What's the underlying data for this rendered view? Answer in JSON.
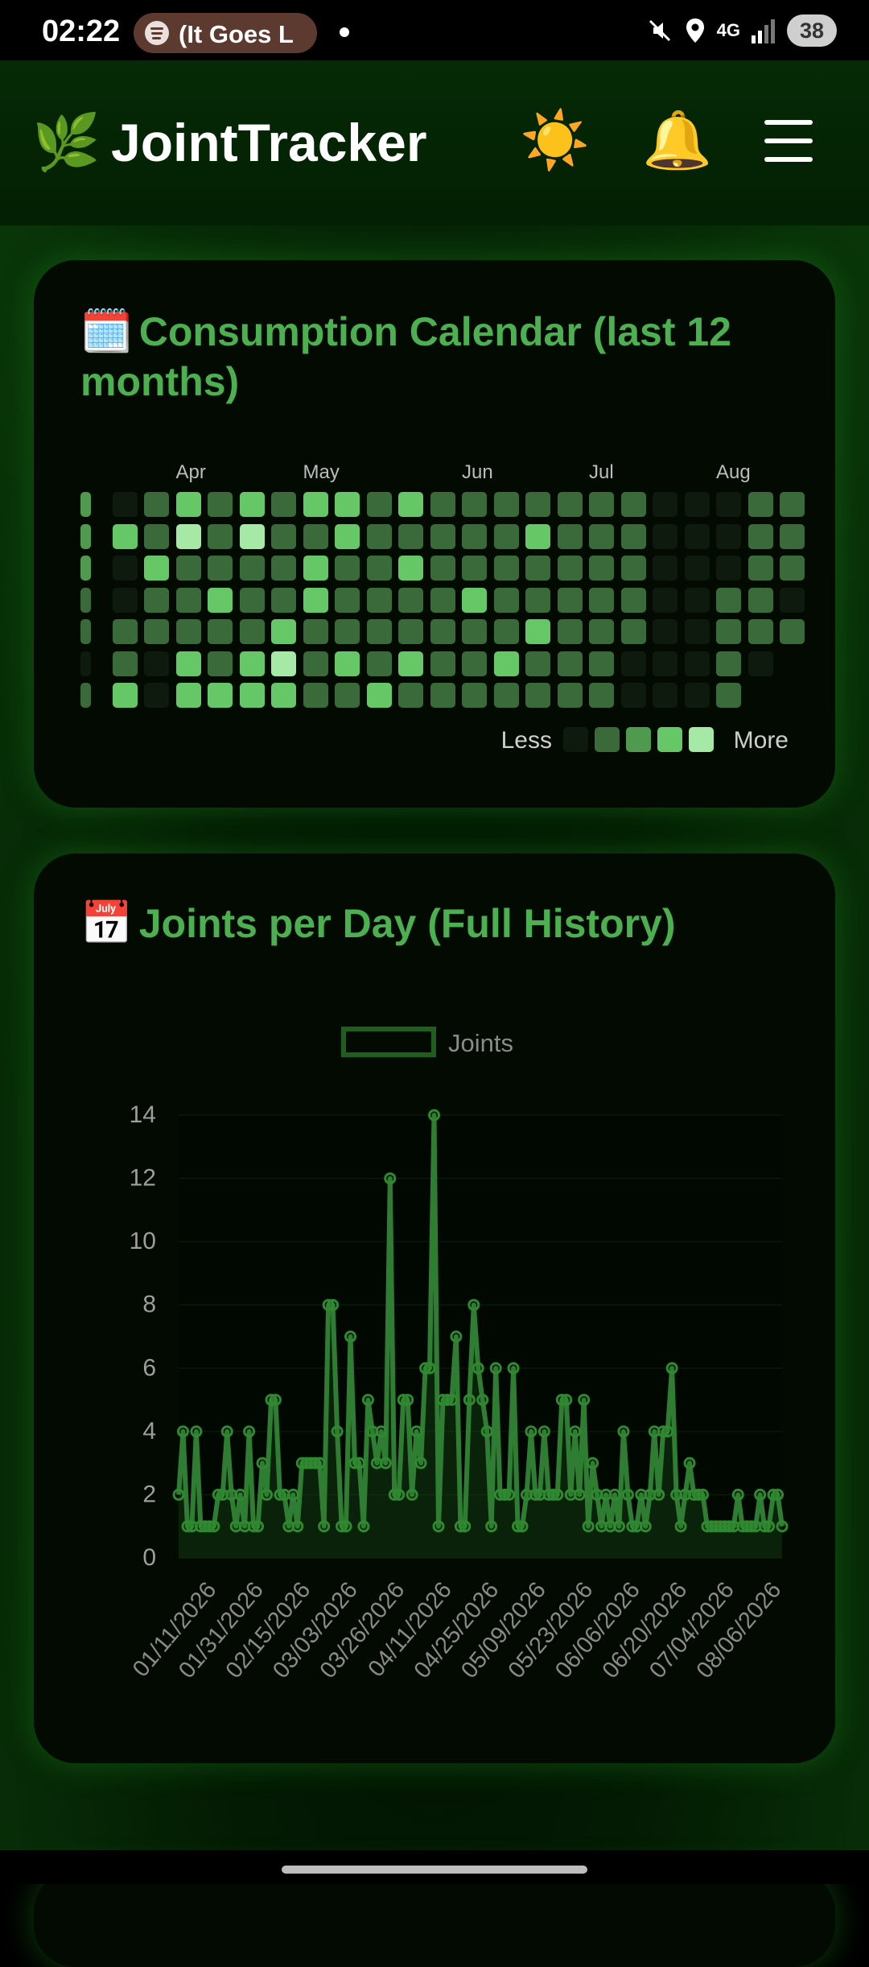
{
  "status_bar": {
    "time": "02:22",
    "now_playing": "(It Goes L",
    "network": "4G",
    "battery": "38"
  },
  "header": {
    "logo_emoji": "🌿",
    "title": "JointTracker",
    "theme_icon": "☀️",
    "bell_icon": "🔔"
  },
  "calendar_card": {
    "emoji": "🗓️",
    "title": "Consumption Calendar (last 12 months)",
    "months": [
      "Apr",
      "May",
      "Jun",
      "Jul",
      "Aug"
    ],
    "month_columns": [
      3,
      7,
      12,
      16,
      20
    ],
    "legend_less": "Less",
    "legend_more": "More",
    "level_colors": [
      "#0f1a0f",
      "#3a6a3a",
      "#4f9a4f",
      "#66c766",
      "#a6e8a6"
    ],
    "first_column_partial": true,
    "weeks": [
      [
        2,
        2,
        2,
        1,
        1,
        0,
        1
      ],
      [
        0,
        3,
        0,
        0,
        1,
        1,
        3
      ],
      [
        1,
        1,
        3,
        1,
        1,
        0,
        0
      ],
      [
        3,
        4,
        1,
        1,
        1,
        3,
        3
      ],
      [
        1,
        1,
        1,
        3,
        1,
        1,
        3
      ],
      [
        3,
        4,
        1,
        1,
        1,
        3,
        3
      ],
      [
        1,
        1,
        1,
        1,
        3,
        4,
        3
      ],
      [
        3,
        1,
        3,
        3,
        1,
        1,
        1
      ],
      [
        3,
        3,
        1,
        1,
        1,
        3,
        1
      ],
      [
        1,
        1,
        1,
        1,
        1,
        1,
        3
      ],
      [
        3,
        1,
        3,
        1,
        1,
        3,
        1
      ],
      [
        1,
        1,
        1,
        1,
        1,
        1,
        1
      ],
      [
        1,
        1,
        1,
        3,
        1,
        1,
        1
      ],
      [
        1,
        1,
        1,
        1,
        1,
        3,
        1
      ],
      [
        1,
        3,
        1,
        1,
        3,
        1,
        1
      ],
      [
        1,
        1,
        1,
        1,
        1,
        1,
        1
      ],
      [
        1,
        1,
        1,
        1,
        1,
        1,
        1
      ],
      [
        1,
        1,
        1,
        1,
        1,
        0,
        0
      ],
      [
        0,
        0,
        0,
        0,
        0,
        0,
        0
      ],
      [
        0,
        0,
        0,
        0,
        0,
        0,
        0
      ],
      [
        0,
        0,
        0,
        1,
        1,
        1,
        1
      ],
      [
        1,
        1,
        1,
        1,
        1,
        0,
        null
      ],
      [
        1,
        1,
        1,
        0,
        1,
        null,
        null
      ]
    ]
  },
  "chart_card": {
    "emoji": "📅",
    "title": "Joints per Day (Full History)"
  },
  "chart_data": {
    "type": "line",
    "title": "Joints per Day (Full History)",
    "legend": "Joints",
    "legend_position": "top",
    "series_color": "#2e7d32",
    "x_tick_labels": [
      "01/11/2026",
      "01/31/2026",
      "02/15/2026",
      "03/03/2026",
      "03/26/2026",
      "04/11/2026",
      "04/25/2026",
      "05/09/2026",
      "05/23/2026",
      "06/06/2026",
      "06/20/2026",
      "07/04/2026",
      "08/06/2026"
    ],
    "ylim": [
      0,
      14
    ],
    "y_ticks": [
      0,
      2,
      4,
      6,
      8,
      10,
      12,
      14
    ],
    "grid": true,
    "values": [
      2,
      4,
      1,
      1,
      4,
      1,
      1,
      1,
      1,
      2,
      2,
      4,
      2,
      1,
      2,
      1,
      4,
      1,
      1,
      3,
      2,
      5,
      5,
      2,
      2,
      1,
      2,
      1,
      3,
      3,
      3,
      3,
      3,
      1,
      8,
      8,
      4,
      1,
      1,
      7,
      3,
      3,
      1,
      5,
      4,
      3,
      4,
      3,
      12,
      2,
      2,
      5,
      5,
      2,
      4,
      3,
      6,
      6,
      14,
      1,
      5,
      5,
      5,
      7,
      1,
      1,
      5,
      8,
      6,
      5,
      4,
      1,
      6,
      2,
      2,
      2,
      6,
      1,
      1,
      2,
      4,
      2,
      2,
      4,
      2,
      2,
      2,
      5,
      5,
      2,
      4,
      2,
      5,
      1,
      3,
      2,
      1,
      2,
      1,
      2,
      1,
      4,
      2,
      1,
      1,
      2,
      1,
      2,
      4,
      2,
      4,
      4,
      6,
      2,
      1,
      2,
      3,
      2,
      2,
      2,
      1,
      1,
      1,
      1,
      1,
      1,
      1,
      2,
      1,
      1,
      1,
      1,
      2,
      1,
      1,
      2,
      2,
      1
    ]
  }
}
